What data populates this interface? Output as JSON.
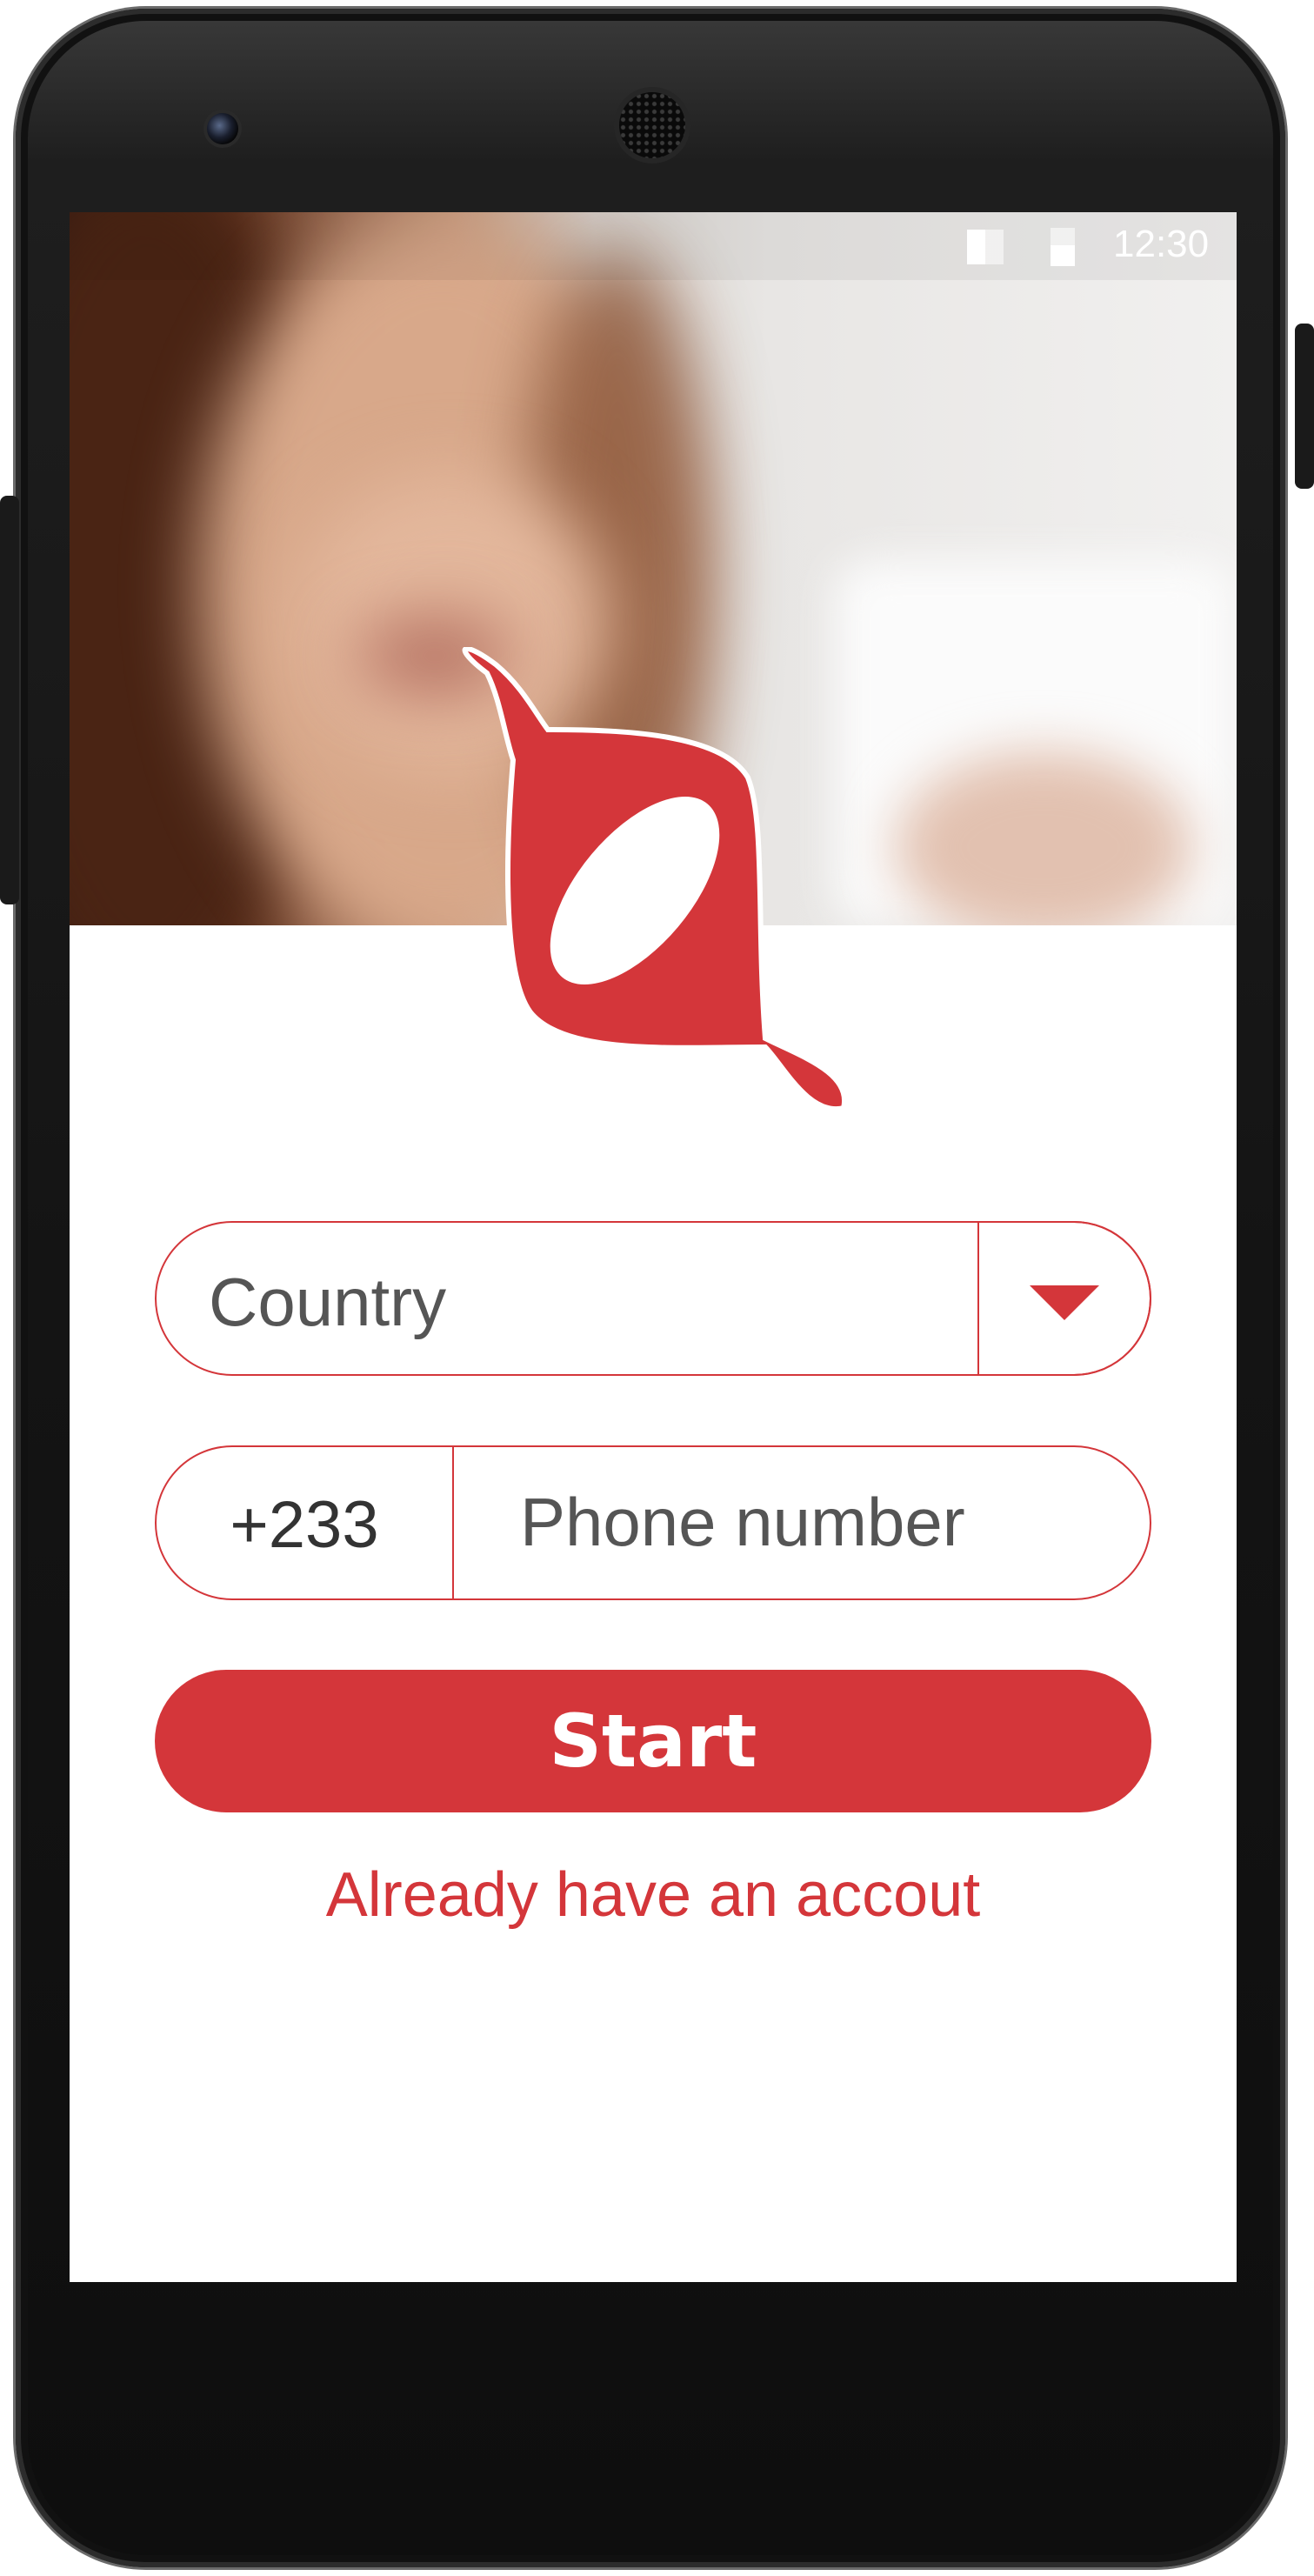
{
  "status_bar": {
    "time": "12:30"
  },
  "form": {
    "country_placeholder": "Country",
    "country_code": "+233",
    "phone_placeholder": "Phone number",
    "start_label": "Start",
    "signin_link": "Already have an accout"
  },
  "colors": {
    "accent": "#d4363a",
    "text": "#555555",
    "background": "#ffffff"
  },
  "icons": {
    "dropdown": "triangle-down-icon",
    "logo": "app-logo"
  }
}
